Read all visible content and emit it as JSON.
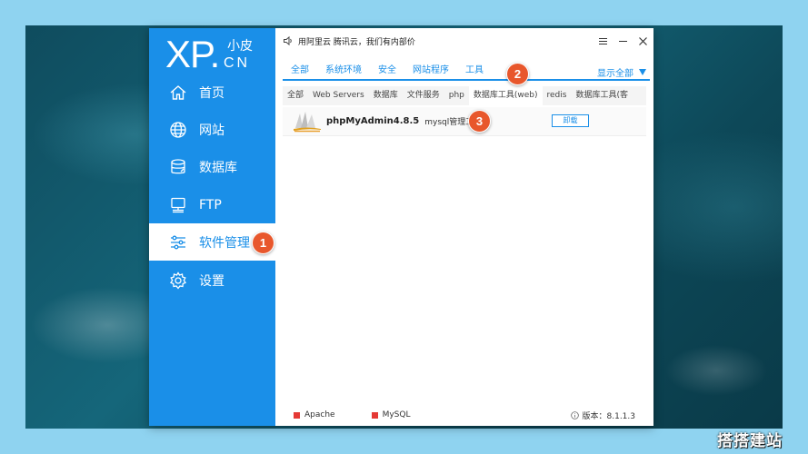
{
  "watermark": "搭搭建站",
  "logo": {
    "main": "XP.",
    "cn_top": "小皮",
    "cn_bottom": "CN"
  },
  "sidebar": {
    "items": [
      {
        "label": "首页",
        "icon": "home-icon"
      },
      {
        "label": "网站",
        "icon": "globe-icon"
      },
      {
        "label": "数据库",
        "icon": "database-icon"
      },
      {
        "label": "FTP",
        "icon": "ftp-icon"
      },
      {
        "label": "软件管理",
        "icon": "sliders-icon",
        "active": true
      },
      {
        "label": "设置",
        "icon": "gear-icon"
      }
    ]
  },
  "titlebar": {
    "notice": "用阿里云 腾讯云，我们有内部价"
  },
  "category_tabs": [
    "全部",
    "系统环境",
    "安全",
    "网站程序",
    "工具"
  ],
  "show_all": "显示全部",
  "sub_tabs": [
    "全部",
    "Web Servers",
    "数据库",
    "文件服务",
    "php",
    "数据库工具(web)",
    "redis",
    "数据库工具(客"
  ],
  "software": [
    {
      "name": "phpMyAdmin4.8.5",
      "desc": "mysql管理工具",
      "action": "卸载"
    }
  ],
  "statusbar": {
    "services": [
      {
        "name": "Apache",
        "color": "#e53935"
      },
      {
        "name": "MySQL",
        "color": "#e53935"
      }
    ],
    "version": "版本：8.1.1.3"
  },
  "callouts": [
    "1",
    "2",
    "3"
  ],
  "colors": {
    "accent": "#1a8fe8",
    "callout": "#e8572c",
    "stopped": "#e53935"
  }
}
